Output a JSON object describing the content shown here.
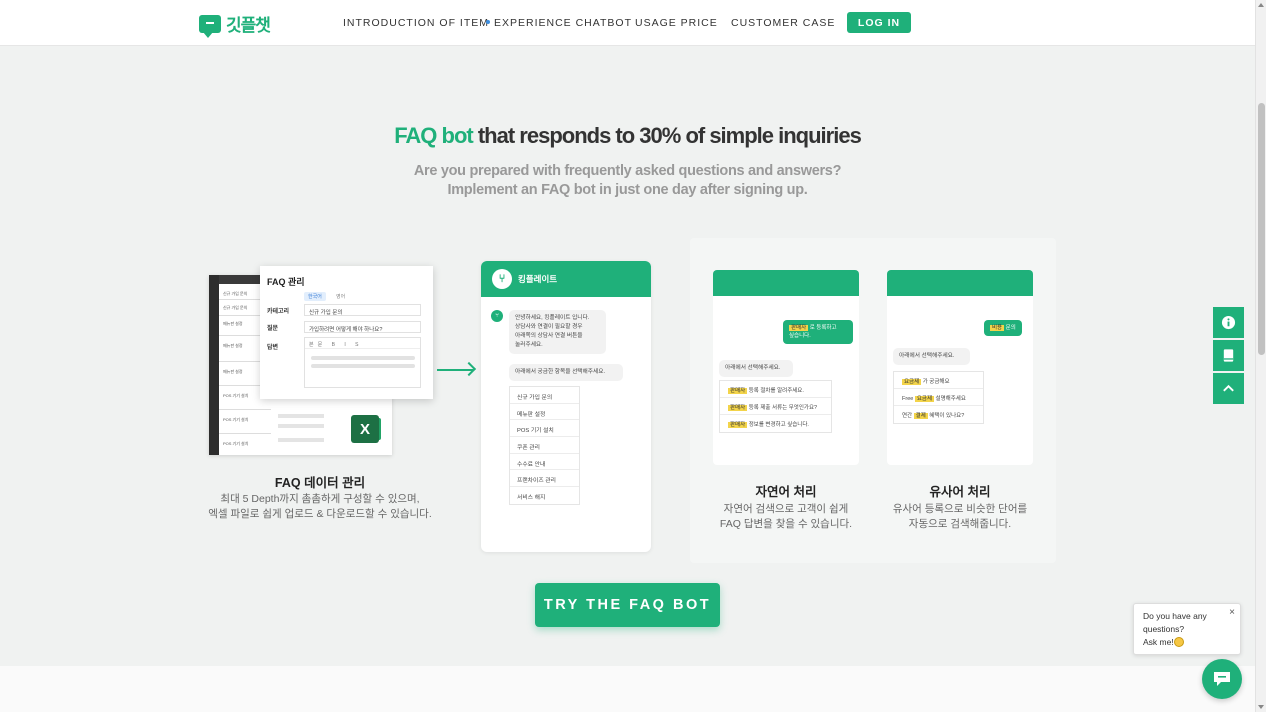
{
  "header": {
    "logo_text": "깃플챗",
    "nav": [
      {
        "label": "INTRODUCTION OF ITEM",
        "active": false
      },
      {
        "label": "EXPERIENCE CHATBOT",
        "active": true
      },
      {
        "label": "USAGE PRICE",
        "active": false
      },
      {
        "label": "CUSTOMER CASE",
        "active": false
      }
    ],
    "login_label": "LOG IN"
  },
  "hero": {
    "title_accent": "FAQ bot",
    "title_rest": " that responds to 30% of simple inquiries",
    "subtitle_line1": "Are you prepared with frequently asked questions and answers?",
    "subtitle_line2": "Implement an FAQ bot in just one day after signing up."
  },
  "faq_data": {
    "panel_title": "FAQ 관리",
    "tabs": [
      "한국어",
      "영어"
    ],
    "labels": [
      "카테고리",
      "질문",
      "답변"
    ],
    "category_value": "신규 가입 문의",
    "question_value": "가입하려면 어떻게 해야 하나요?",
    "toolbar": "본문 B I S",
    "sheet_rows": [
      "신규 가입 문의",
      "신규 가입 문의",
      "메뉴판 설정",
      "메뉴판 설정",
      "메뉴판 설정",
      "POS 기기 설치",
      "POS 기기 설치",
      "POS 기기 설치"
    ],
    "excel_label": "X",
    "card_title": "FAQ 데이터 관리",
    "card_desc_1": "최대 5 Depth까지 촘촘하게 구성할 수 있으며,",
    "card_desc_2": "엑셀 파일로 쉽게 업로드 & 다운로드할 수 있습니다."
  },
  "chat": {
    "name": "킹플레이트",
    "greeting": [
      "안녕하세요, 킹플레이트 입니다.",
      "상담사와 연결이 필요할 경우",
      "아래쪽의 상담사 연결 버튼을",
      "눌러주세요."
    ],
    "prompt": "아래에서 궁금한 항목을 선택해주세요.",
    "options": [
      "신규 가입 문의",
      "메뉴판 설정",
      "POS 기기 설치",
      "쿠폰 관리",
      "수수료 안내",
      "프랜차이즈 관리",
      "서비스 해지"
    ]
  },
  "nlp": {
    "user_msg_hl": "판매자",
    "user_msg_rest": " 로 등록하고",
    "user_msg_line2": "싶습니다.",
    "prompt": "아래에서 선택해주세요.",
    "options": [
      {
        "hl": "판매자",
        "text": " 등록 절차를 알려주세요."
      },
      {
        "hl": "판매자",
        "text": " 등록 제출 서류는 무엇인가요?"
      },
      {
        "hl": "판매자",
        "text": " 정보를 변경하고 싶습니다."
      }
    ],
    "title": "자연어 처리",
    "desc_1": "자연어 검색으로 고객이 쉽게",
    "desc_2": "FAQ 답변을 찾을 수 있습니다."
  },
  "synonym": {
    "user_msg_hl": "비용",
    "user_msg_rest": " 문의",
    "prompt": "아래에서 선택해주세요.",
    "options": [
      {
        "pre": "",
        "hl": "요금제",
        "text": " 가 궁금해요"
      },
      {
        "pre": "Free ",
        "hl": "요금제",
        "text": " 설명해주세요"
      },
      {
        "pre": "연간 ",
        "hl": "결제",
        "text": " 혜택이 있나요?"
      }
    ],
    "title": "유사어 처리",
    "desc_1": "유사어 등록으로 비슷한 단어를",
    "desc_2": "자동으로 검색해줍니다."
  },
  "cta_label": "TRY THE FAQ BOT",
  "widget": {
    "tooltip_line1": "Do you have any",
    "tooltip_line2": "questions?",
    "tooltip_line3": "Ask me!",
    "close": "×"
  },
  "colors": {
    "brand": "#1fb07a",
    "highlight": "#f3d44a",
    "nav_dot": "#3b8de0"
  },
  "icons": [
    "info-icon",
    "book-icon",
    "arrow-up-icon",
    "chat-icon",
    "fork-knife-icon"
  ]
}
